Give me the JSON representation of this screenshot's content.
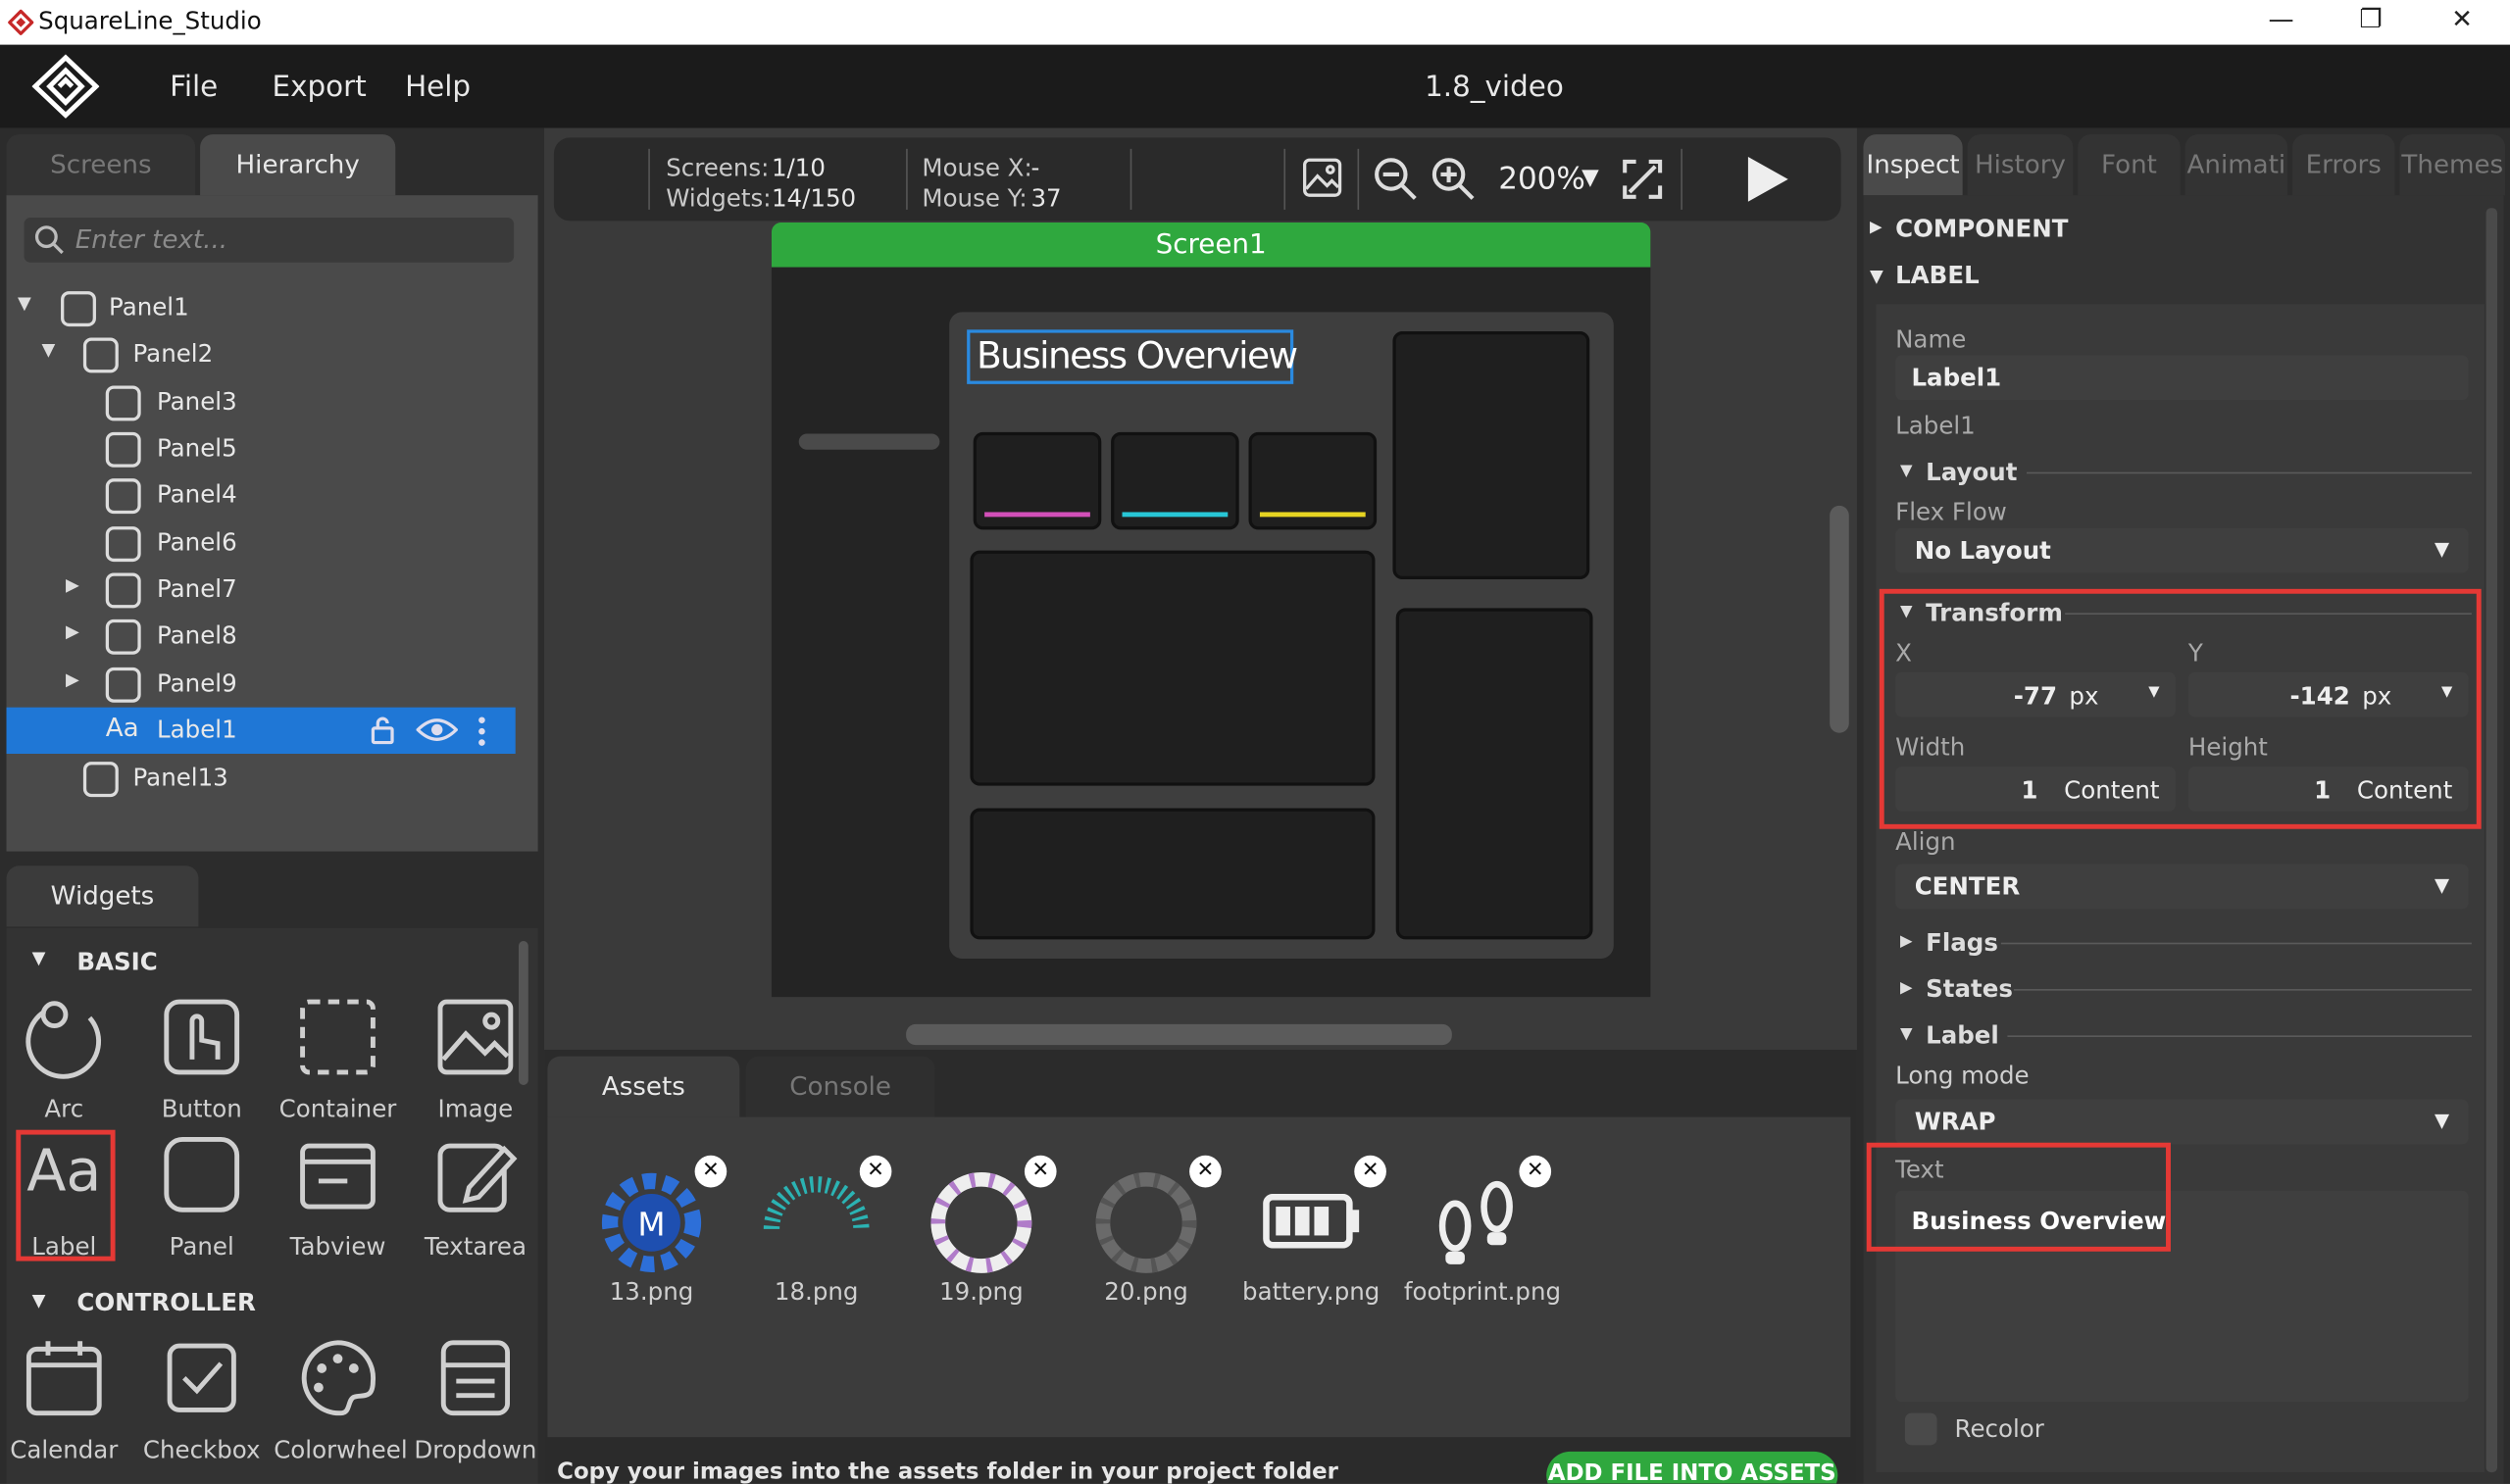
{
  "window": {
    "title": "SquareLine_Studio",
    "minimize": "—",
    "restore": "❐",
    "close": "✕"
  },
  "menu": {
    "file": "File",
    "export": "Export",
    "help": "Help",
    "project": "1.8_video"
  },
  "left": {
    "tabs": {
      "screens": "Screens",
      "hierarchy": "Hierarchy"
    },
    "search_placeholder": "Enter text...",
    "tree": [
      {
        "label": "Panel1"
      },
      {
        "label": "Panel2"
      },
      {
        "label": "Panel3"
      },
      {
        "label": "Panel5"
      },
      {
        "label": "Panel4"
      },
      {
        "label": "Panel6"
      },
      {
        "label": "Panel7"
      },
      {
        "label": "Panel8"
      },
      {
        "label": "Panel9"
      },
      {
        "label": "Label1"
      },
      {
        "label": "Panel13"
      }
    ],
    "label_icon_text": "Aa",
    "widgets_tab": "Widgets",
    "basic_heading": "BASIC",
    "controller_heading": "CONTROLLER",
    "basic": [
      "Arc",
      "Button",
      "Container",
      "Image",
      "Label",
      "Panel",
      "Tabview",
      "Textarea"
    ],
    "controller": [
      "Calendar",
      "Checkbox",
      "Colorwheel",
      "Dropdown"
    ]
  },
  "toolbar": {
    "screens_label": "Screens:",
    "screens_value": "1/10",
    "widgets_label": "Widgets:",
    "widgets_value": "14/150",
    "mouse_x_label": "Mouse X:",
    "mouse_x_value": "-",
    "mouse_y_label": "Mouse Y:",
    "mouse_y_value": "37",
    "zoom": "200%"
  },
  "canvas": {
    "screen_name": "Screen1",
    "label_text": "Business Overview"
  },
  "bottom": {
    "tabs": {
      "assets": "Assets",
      "console": "Console"
    },
    "assets": [
      "13.png",
      "18.png",
      "19.png",
      "20.png",
      "battery.png",
      "footprint.png"
    ],
    "remove_glyph": "✕",
    "hint": "Copy your images into the assets folder in your project folder",
    "add_button": "ADD FILE INTO ASSETS"
  },
  "inspector": {
    "tabs": [
      "Inspect",
      "History",
      "Font",
      "Animati",
      "Errors",
      "Themes"
    ],
    "component_heading": "COMPONENT",
    "label_heading": "LABEL",
    "name_label": "Name",
    "name_value": "Label1",
    "type_label": "Label1",
    "layout_heading": "Layout",
    "flex_flow_label": "Flex Flow",
    "flex_flow_value": "No Layout",
    "transform_heading": "Transform",
    "x_label": "X",
    "x_value": "-77",
    "x_unit": "px",
    "y_label": "Y",
    "y_value": "-142",
    "y_unit": "px",
    "width_label": "Width",
    "width_value": "1",
    "width_unit": "Content",
    "height_label": "Height",
    "height_value": "1",
    "height_unit": "Content",
    "align_label": "Align",
    "align_value": "CENTER",
    "flags_heading": "Flags",
    "states_heading": "States",
    "label_sub_heading": "Label",
    "long_mode_label": "Long mode",
    "long_mode_value": "WRAP",
    "text_label": "Text",
    "text_value": "Business Overview",
    "recolor_label": "Recolor"
  },
  "colors": {
    "accent_green": "#2fa83e",
    "selection_blue": "#1f77d6",
    "highlight_red": "#e53935"
  }
}
